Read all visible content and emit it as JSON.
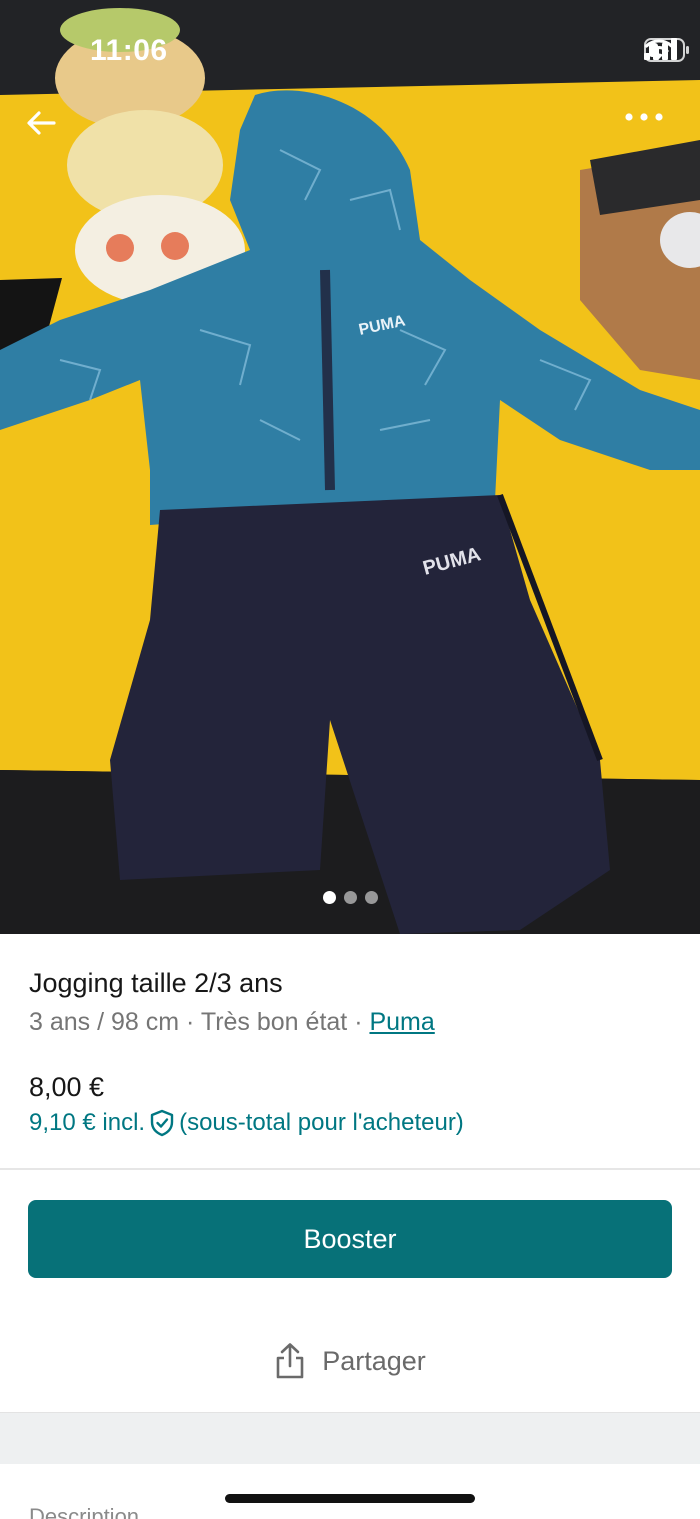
{
  "status_bar": {
    "time": "11:06"
  },
  "gallery": {
    "image_description_icon": "photo-placeholder-icon",
    "image_count": 3,
    "current_index": 1
  },
  "item": {
    "title": "Jogging taille 2/3 ans",
    "size": "3 ans / 98 cm",
    "condition": "Très bon état",
    "separator": "·",
    "brand": "Puma",
    "price": "8,00 €",
    "price_incl": "9,10 € incl.",
    "price_incl_note": "(sous-total pour l'acheteur)"
  },
  "actions": {
    "booster_label": "Booster",
    "share_label": "Partager"
  },
  "description": {
    "label": "Description"
  },
  "colors": {
    "accent": "#007782",
    "button": "#077178"
  }
}
